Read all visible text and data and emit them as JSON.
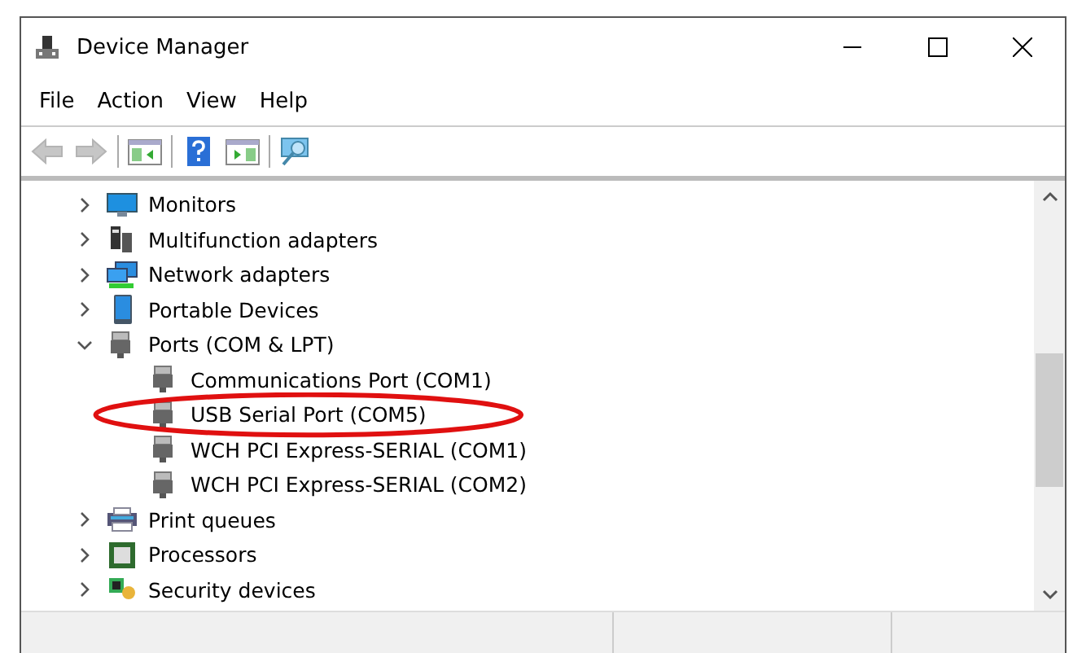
{
  "window": {
    "title": "Device Manager"
  },
  "menu": [
    {
      "label": "File"
    },
    {
      "label": "Action"
    },
    {
      "label": "View"
    },
    {
      "label": "Help"
    }
  ],
  "toolbar": [
    {
      "kind": "back",
      "disabled": true
    },
    {
      "kind": "forward",
      "disabled": true
    },
    {
      "kind": "separator"
    },
    {
      "kind": "tree-pane",
      "disabled": false
    },
    {
      "kind": "separator"
    },
    {
      "kind": "help",
      "disabled": false
    },
    {
      "kind": "action-pane",
      "disabled": false
    },
    {
      "kind": "separator"
    },
    {
      "kind": "scan",
      "disabled": false
    }
  ],
  "tree": [
    {
      "label": "Monitors",
      "kind": "monitor",
      "expanded": false
    },
    {
      "label": "Multifunction adapters",
      "kind": "multifunction",
      "expanded": false
    },
    {
      "label": "Network adapters",
      "kind": "network",
      "expanded": false
    },
    {
      "label": "Portable Devices",
      "kind": "portable",
      "expanded": false
    },
    {
      "label": "Ports (COM & LPT)",
      "kind": "port",
      "expanded": true,
      "children": [
        {
          "label": "Communications Port (COM1)",
          "kind": "port",
          "circled": false
        },
        {
          "label": "USB Serial Port (COM5)",
          "kind": "port",
          "circled": true
        },
        {
          "label": "WCH PCI Express-SERIAL (COM1)",
          "kind": "port",
          "circled": false
        },
        {
          "label": "WCH PCI Express-SERIAL (COM2)",
          "kind": "port",
          "circled": false
        }
      ]
    },
    {
      "label": "Print queues",
      "kind": "printer",
      "expanded": false
    },
    {
      "label": "Processors",
      "kind": "processor",
      "expanded": false
    },
    {
      "label": "Security devices",
      "kind": "security",
      "expanded": false
    }
  ]
}
